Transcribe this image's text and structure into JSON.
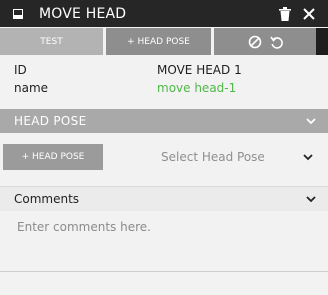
{
  "window": {
    "title": "MOVE HEAD"
  },
  "toolbar": {
    "test_label": "TEST",
    "head_pose_label": "+ HEAD POSE"
  },
  "properties": [
    {
      "key": "ID",
      "value": "MOVE  HEAD  1",
      "value_color": "#1f1f1f"
    },
    {
      "key": "name",
      "value": "move head-1",
      "value_color": "#4fb848"
    }
  ],
  "head_pose_section": {
    "title": "HEAD POSE",
    "add_button_label": "+ HEAD POSE",
    "select_placeholder": "Select Head Pose"
  },
  "comments_section": {
    "title": "Comments",
    "placeholder": "Enter comments here."
  },
  "icons": {
    "window": "window-icon",
    "trash": "trash-icon",
    "close": "close-icon",
    "block": "block-icon",
    "undo": "undo-icon",
    "chevron": "chevron-down-icon"
  }
}
